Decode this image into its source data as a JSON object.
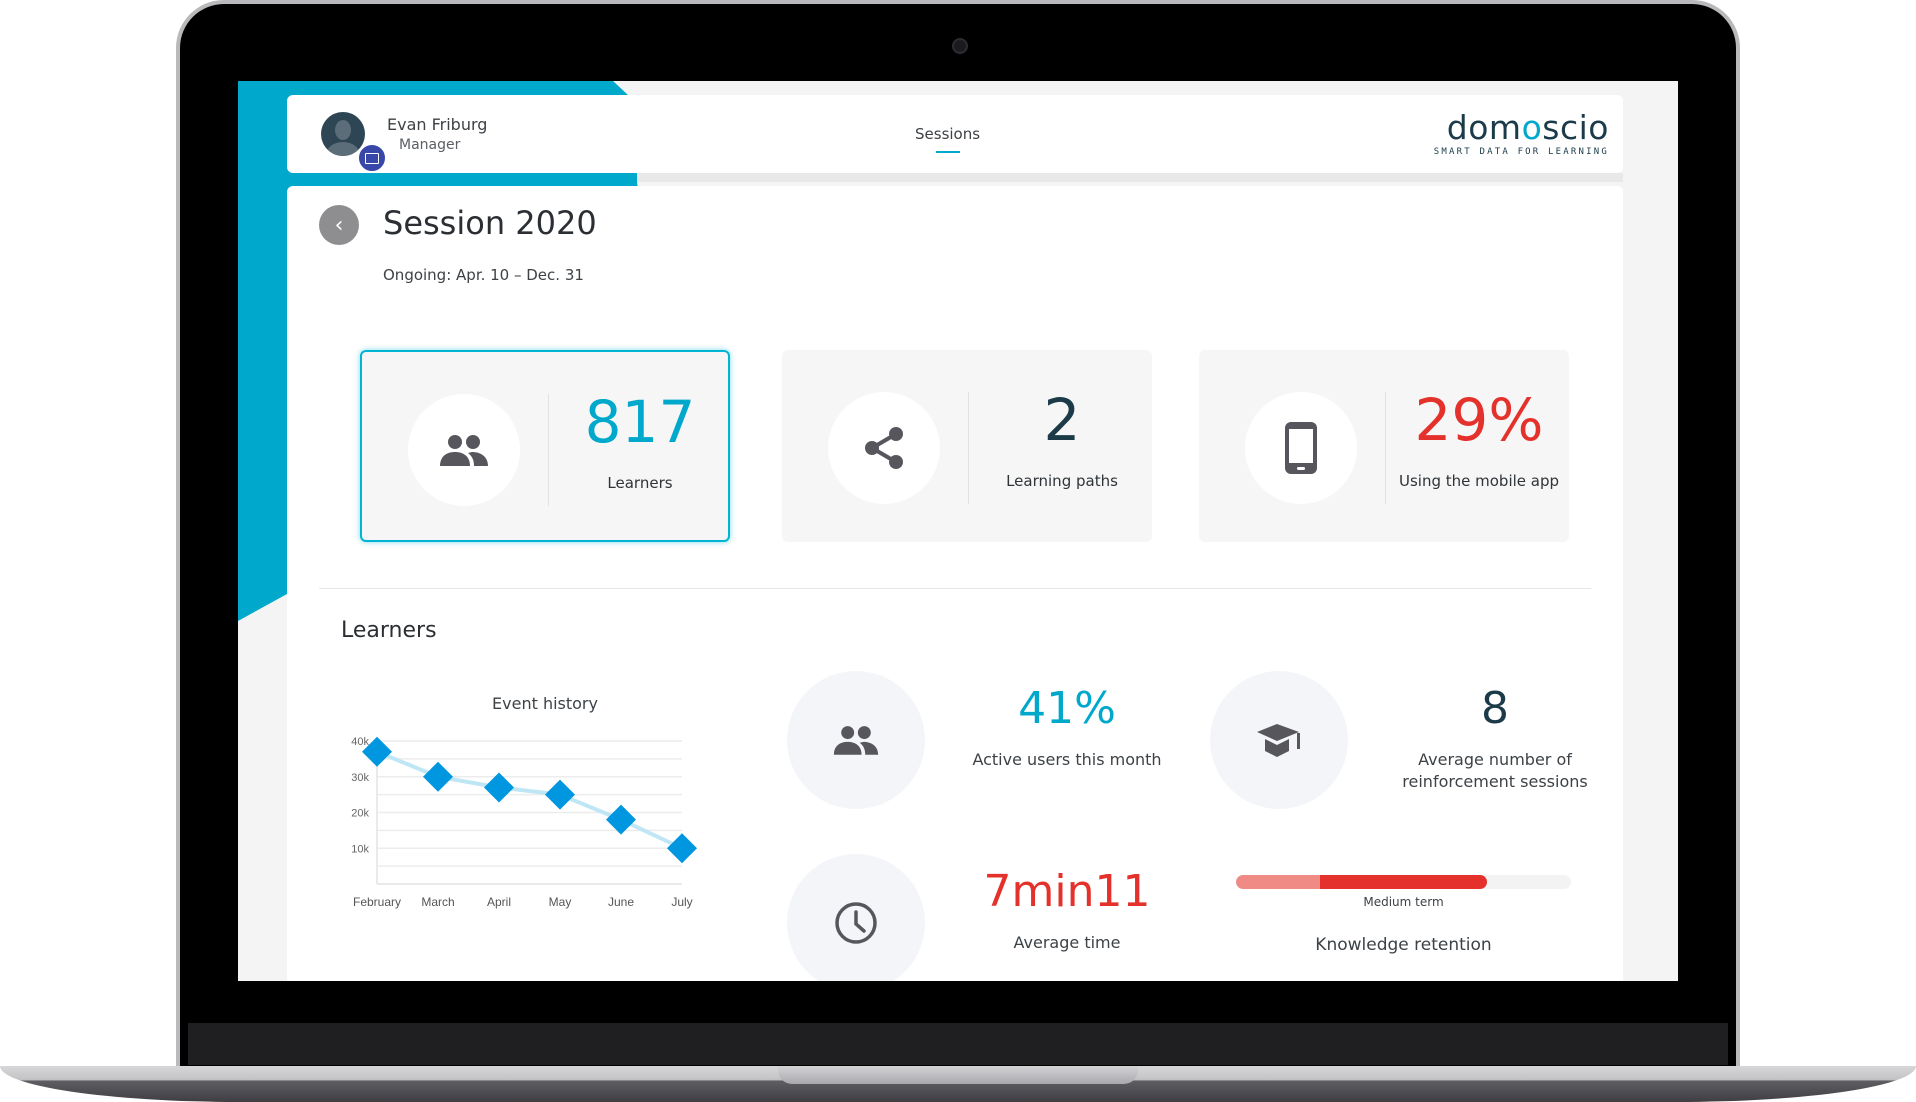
{
  "header": {
    "user_name": "Evan Friburg",
    "user_role": "Manager",
    "nav_sessions": "Sessions",
    "logo_word_a": "dom",
    "logo_word_b": "o",
    "logo_word_c": "scio",
    "logo_tagline": "SMART DATA FOR LEARNING"
  },
  "page": {
    "back_icon": "‹",
    "title": "Session 2020",
    "subtitle": "Ongoing: Apr. 10 – Dec. 31"
  },
  "kpis": [
    {
      "value": "817",
      "label": "Learners",
      "color": "#00a8cc",
      "icon": "people-icon"
    },
    {
      "value": "2",
      "label": "Learning paths",
      "color": "#1c3a48",
      "icon": "share-icon"
    },
    {
      "value": "29%",
      "label": "Using the mobile app",
      "color": "#e4312b",
      "icon": "mobile-icon"
    }
  ],
  "learners_section": {
    "title": "Learners",
    "stats": [
      {
        "value": "41%",
        "label": "Active users this month",
        "color": "#00a8cc"
      },
      {
        "value": "8",
        "label_line1": "Average number of",
        "label_line2": "reinforcement sessions",
        "color": "#1c3a48"
      },
      {
        "value": "7min11",
        "label": "Average time",
        "color": "#e4312b"
      }
    ],
    "retention": {
      "term_label": "Medium term",
      "name": "Knowledge retention",
      "short_term_fraction": 0.25,
      "medium_term_fraction": 0.75
    }
  },
  "chart_data": {
    "type": "line",
    "title": "Event history",
    "categories": [
      "February",
      "March",
      "April",
      "May",
      "June",
      "July"
    ],
    "series": [
      {
        "name": "Events",
        "values": [
          37000,
          30000,
          27000,
          25000,
          18000,
          10000
        ]
      }
    ],
    "yticks": [
      "10k",
      "20k",
      "30k",
      "40k"
    ],
    "ytick_values": [
      10000,
      20000,
      30000,
      40000
    ],
    "ylim": [
      0,
      40000
    ],
    "xlabel": "",
    "ylabel": "",
    "grid": true,
    "color": "#0096e0"
  }
}
